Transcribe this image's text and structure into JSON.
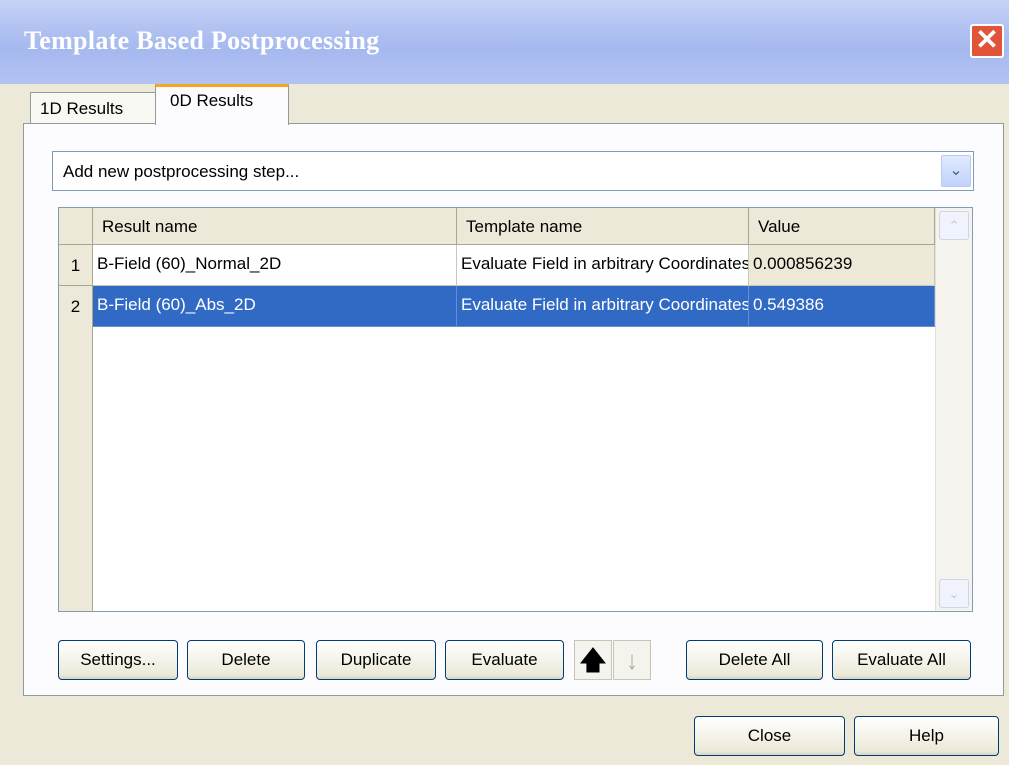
{
  "window": {
    "title": "Template Based Postprocessing",
    "close_glyph": "✕"
  },
  "tabs": [
    {
      "label": "1D Results",
      "active": false
    },
    {
      "label": "0D Results",
      "active": true
    }
  ],
  "combo": {
    "value": "Add new postprocessing step...",
    "arrow_glyph": "⌄"
  },
  "table": {
    "columns": [
      "Result name",
      "Template name",
      "Value"
    ],
    "rows": [
      {
        "index": "1",
        "result_name": "B-Field (60)_Normal_2D",
        "template_name": "Evaluate Field in arbitrary Coordinates",
        "value": "0.000856239",
        "selected": false
      },
      {
        "index": "2",
        "result_name": "B-Field (60)_Abs_2D",
        "template_name": "Evaluate Field in arbitrary Coordinates",
        "value": "0.549386",
        "selected": true
      }
    ],
    "scroll_up_glyph": "⌃",
    "scroll_down_glyph": "⌄"
  },
  "toolbar": {
    "settings": "Settings...",
    "delete": "Delete",
    "duplicate": "Duplicate",
    "evaluate": "Evaluate",
    "move_up_glyph": "🡅",
    "move_down_glyph": "↓",
    "delete_all": "Delete All",
    "evaluate_all": "Evaluate All"
  },
  "footer": {
    "close": "Close",
    "help": "Help"
  },
  "colors": {
    "selection": "#316ac5",
    "titlebar": "#aebff0",
    "tab_highlight": "#f8a51f"
  },
  "icons": {
    "close": "close-icon",
    "dropdown": "chevron-down-icon",
    "up": "arrow-up-icon",
    "down": "arrow-down-icon"
  }
}
